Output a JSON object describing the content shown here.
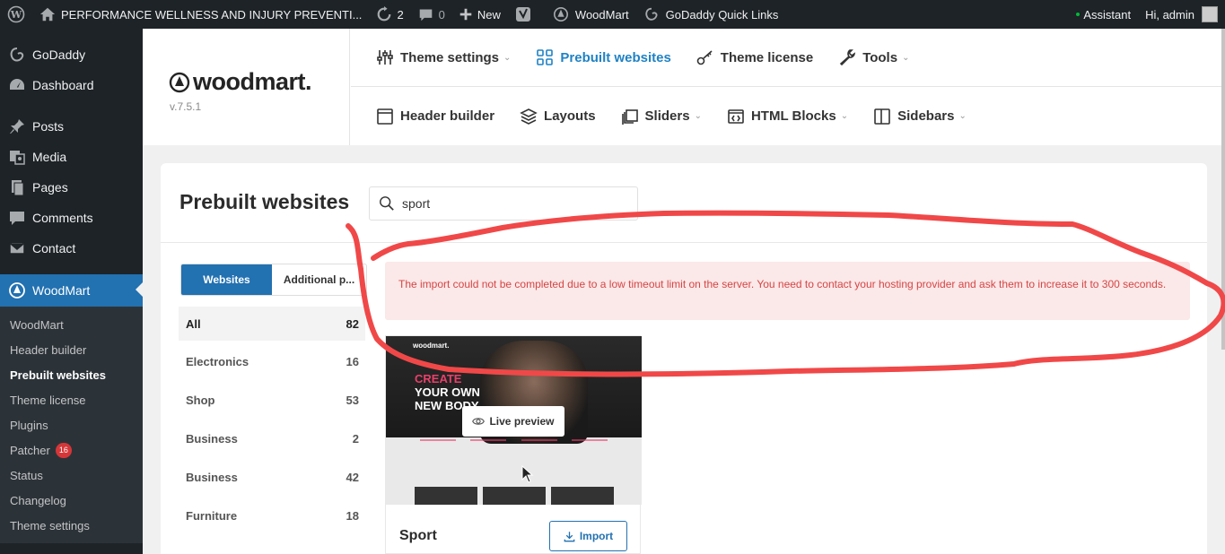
{
  "adminbar": {
    "site_title": "PERFORMANCE WELLNESS AND INJURY PREVENTI...",
    "updates_count": "2",
    "comments_count": "0",
    "new_label": "New",
    "woodmart_label": "WoodMart",
    "godaddy_links_label": "GoDaddy Quick Links",
    "assistant_label": "Assistant",
    "greeting": "Hi, admin"
  },
  "sidebar": {
    "items": [
      {
        "label": "GoDaddy",
        "icon": "godaddy-icon"
      },
      {
        "label": "Dashboard",
        "icon": "dashboard-icon"
      },
      {
        "label": "Posts",
        "icon": "pin-icon"
      },
      {
        "label": "Media",
        "icon": "media-icon"
      },
      {
        "label": "Pages",
        "icon": "pages-icon"
      },
      {
        "label": "Comments",
        "icon": "comment-icon"
      },
      {
        "label": "Contact",
        "icon": "mail-icon"
      },
      {
        "label": "WoodMart",
        "icon": "woodmart-icon"
      }
    ],
    "submenu": [
      {
        "label": "WoodMart"
      },
      {
        "label": "Header builder"
      },
      {
        "label": "Prebuilt websites"
      },
      {
        "label": "Theme license"
      },
      {
        "label": "Plugins"
      },
      {
        "label": "Patcher",
        "badge": "16"
      },
      {
        "label": "Status"
      },
      {
        "label": "Changelog"
      },
      {
        "label": "Theme settings"
      }
    ]
  },
  "woodmart": {
    "logo": "woodmart.",
    "version": "v.7.5.1",
    "nav_primary": [
      {
        "label": "Theme settings"
      },
      {
        "label": "Prebuilt websites"
      },
      {
        "label": "Theme license"
      },
      {
        "label": "Tools"
      }
    ],
    "nav_secondary": [
      {
        "label": "Header builder"
      },
      {
        "label": "Layouts"
      },
      {
        "label": "Sliders"
      },
      {
        "label": "HTML Blocks"
      },
      {
        "label": "Sidebars"
      }
    ]
  },
  "main": {
    "title": "Prebuilt websites",
    "search_value": "sport",
    "tabs": [
      {
        "label": "Websites"
      },
      {
        "label": "Additional p..."
      }
    ],
    "categories": [
      {
        "name": "All",
        "count": "82"
      },
      {
        "name": "Electronics",
        "count": "16"
      },
      {
        "name": "Shop",
        "count": "53"
      },
      {
        "name": "Business",
        "count": "2"
      },
      {
        "name": "Business",
        "count": "42"
      },
      {
        "name": "Furniture",
        "count": "18"
      }
    ],
    "error_message": "The import could not be completed due to a low timeout limit on the server. You need to contact your hosting provider and ask them to increase it to 300 seconds.",
    "card": {
      "title": "Sport",
      "thumb_brand": "woodmart.",
      "thumb_headline_1": "CREATE",
      "thumb_headline_2": "YOUR OWN",
      "thumb_headline_3": "NEW BODY",
      "live_preview_label": "Live preview",
      "import_label": "Import"
    }
  },
  "colors": {
    "adminbar_bg": "#1d2327",
    "accent": "#2271b1",
    "woodmart_link": "#1f82c4",
    "error_text": "#d64545",
    "error_bg": "#fbe8e8",
    "annotation": "#f04848"
  }
}
